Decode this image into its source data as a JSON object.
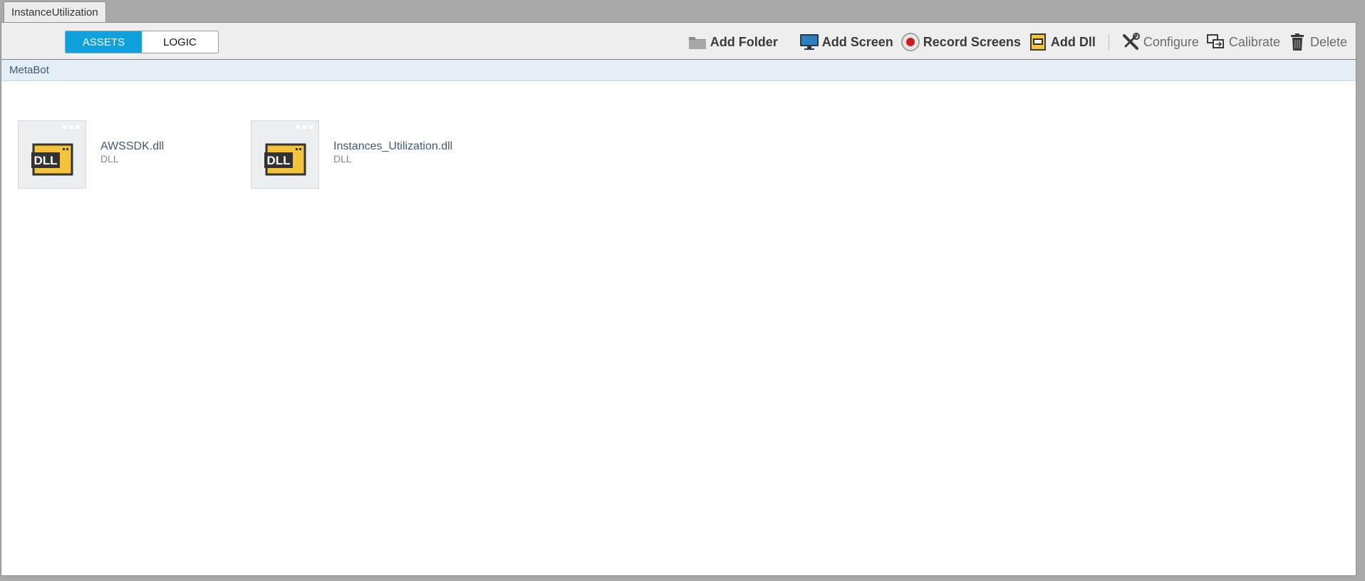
{
  "tab": {
    "label": "InstanceUtilization"
  },
  "view_toggle": {
    "assets_label": "ASSETS",
    "logic_label": "LOGIC",
    "selected": "ASSETS"
  },
  "toolbar": {
    "add_folder": "Add Folder",
    "add_screen": "Add Screen",
    "record_screens": "Record Screens",
    "add_dll": "Add Dll",
    "configure": "Configure",
    "calibrate": "Calibrate",
    "delete": "Delete"
  },
  "breadcrumb": {
    "path": "MetaBot"
  },
  "assets": [
    {
      "name": "AWSSDK.dll",
      "type": "DLL",
      "icon": "dll-icon",
      "icon_text": "DLL"
    },
    {
      "name": "Instances_Utilization.dll",
      "type": "DLL",
      "icon": "dll-icon",
      "icon_text": "DLL"
    }
  ],
  "colors": {
    "accent": "#0ea1dc",
    "toolbar_bg": "#eeeeee",
    "pathbar_bg": "#e3edf5",
    "dll_yellow": "#f5c23c",
    "record_red": "#d0191d"
  }
}
